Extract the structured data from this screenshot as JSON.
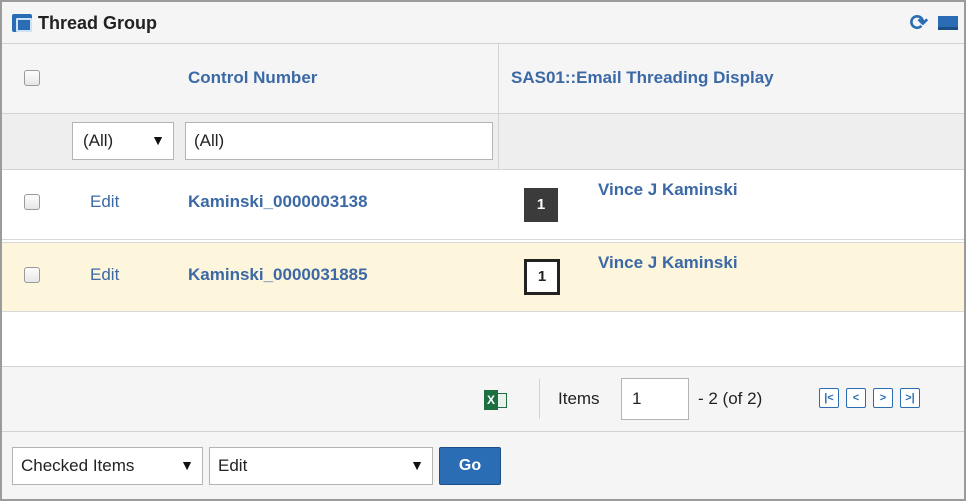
{
  "window": {
    "title": "Thread Group",
    "icons": [
      "thread-group-icon",
      "refresh-icon",
      "minimize-icon"
    ]
  },
  "table": {
    "columns": [
      "Control Number",
      "SAS01::Email Threading Display"
    ],
    "filters": {
      "select_value": "(All)",
      "text_value": "(All)"
    },
    "rows": [
      {
        "action": "Edit",
        "control_number": "Kaminski_0000003138",
        "badge": "1",
        "badge_style": "dark",
        "email_name": "Vince J Kaminski"
      },
      {
        "action": "Edit",
        "control_number": "Kaminski_0000031885",
        "badge": "1",
        "badge_style": "outline",
        "email_name": "Vince J Kaminski"
      }
    ],
    "highlight_color": "#fdf5dc"
  },
  "pager": {
    "items_label": "Items",
    "page_start": "1",
    "range_text": "- 2 (of 2)",
    "buttons": [
      "first-page",
      "previous-page",
      "next-page",
      "last-page"
    ]
  },
  "actions": {
    "scope": "Checked Items",
    "operation": "Edit",
    "go_label": "Go"
  },
  "colors": {
    "link": "#3b69a6",
    "accent": "#2a6db5"
  }
}
